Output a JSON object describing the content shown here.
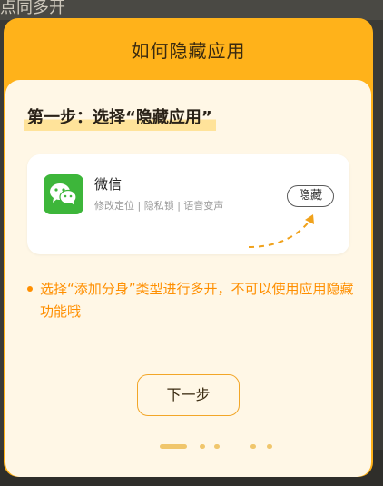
{
  "background": {
    "text": "点同多开"
  },
  "modal": {
    "title": "如何隐藏应用",
    "step_title": "第一步：选择“隐藏应用”",
    "card": {
      "app_name": "微信",
      "tags": "修改定位 | 隐私锁 | 语音变声",
      "hide_button": "隐藏"
    },
    "note": "选择“添加分身”类型进行多开，不可以使用应用隐藏功能哦",
    "next_button": "下一步",
    "pager": {
      "total": 5,
      "current": 1
    }
  },
  "colors": {
    "header": "#ffb21a",
    "panel": "#fff7e6",
    "accent": "#ff8f00",
    "wechat_green": "#3db63a"
  },
  "icons": [
    "wechat-icon",
    "dashed-arrow-icon"
  ]
}
